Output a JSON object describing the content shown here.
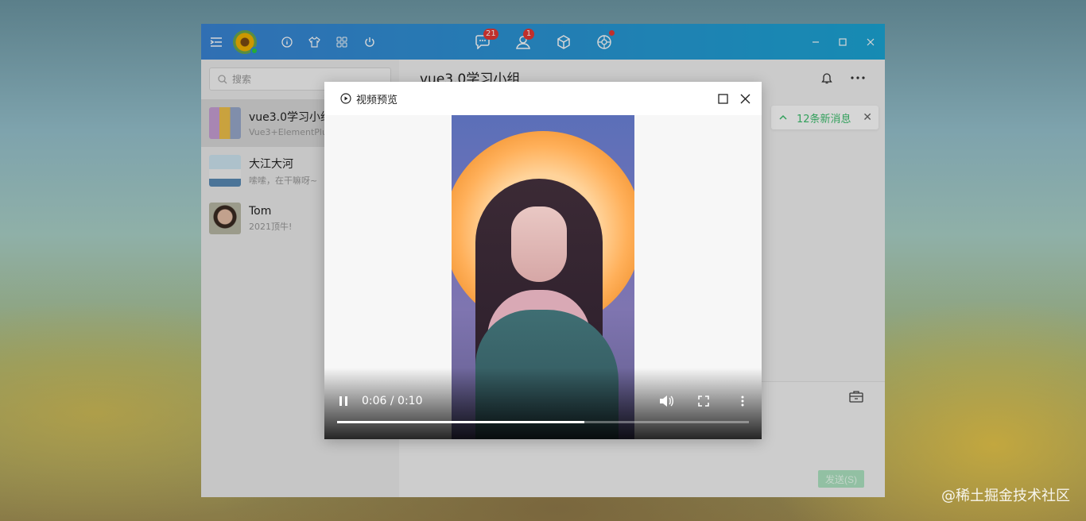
{
  "titlebar": {
    "messages_badge": "21",
    "contacts_badge": "1"
  },
  "sidebar": {
    "search_placeholder": "搜索",
    "chats": [
      {
        "name": "vue3.0学习小组",
        "preview": "Vue3+ElementPlus"
      },
      {
        "name": "大江大河",
        "preview": "嗦嗦，在干嘛呀~"
      },
      {
        "name": "Tom",
        "preview": "2021顶牛!"
      }
    ]
  },
  "main": {
    "title": "vue3.0学习小组",
    "new_messages": "12条新消息",
    "send_label": "发送(S)"
  },
  "dialog": {
    "title": "视频预览"
  },
  "video": {
    "time": "0:06 / 0:10",
    "progress": 0.6
  },
  "watermark": "@稀土掘金技术社区",
  "colors": {
    "titlebar_start": "#3a85d6",
    "titlebar_end": "#1ba6d6",
    "new_messages": "#3dbf6e",
    "badge": "#e53935"
  }
}
